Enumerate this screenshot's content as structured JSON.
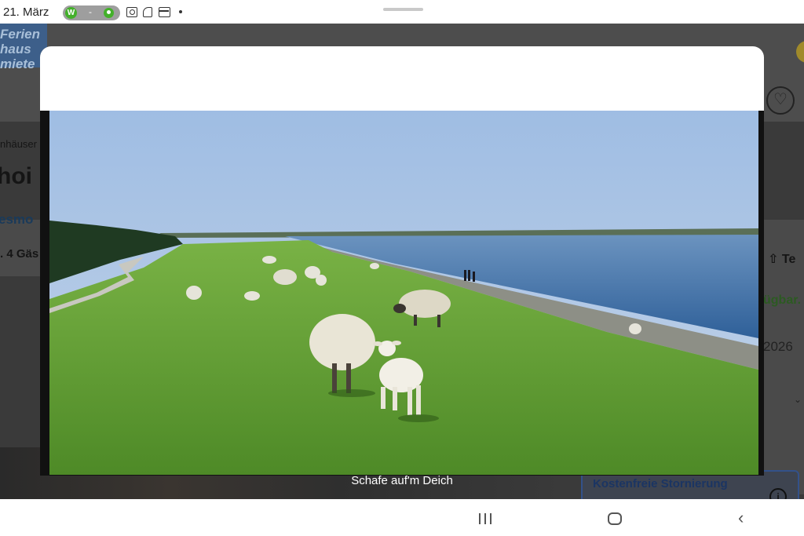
{
  "status_bar": {
    "date": "21. März",
    "pill_dash": "-"
  },
  "background_page": {
    "logo": "Ferien haus miete",
    "breadcrumb": "nhäuser",
    "title": "hoi",
    "subtitle": "esmo",
    "guests": ". 4 Gäs",
    "share_label": "Te",
    "availability": "ügbar.",
    "year": "2026",
    "free_cancellation": "Kostenfreie Stornierung",
    "info_glyph": "i"
  },
  "gallery": {
    "caption": "Schafe auf'm Deich"
  },
  "colors": {
    "sky": "#a9c4e6",
    "grass": "#5f9b2e",
    "water": "#3d6fa8",
    "modal_header": "#ffffff",
    "overlay": "#3a3a3a"
  }
}
